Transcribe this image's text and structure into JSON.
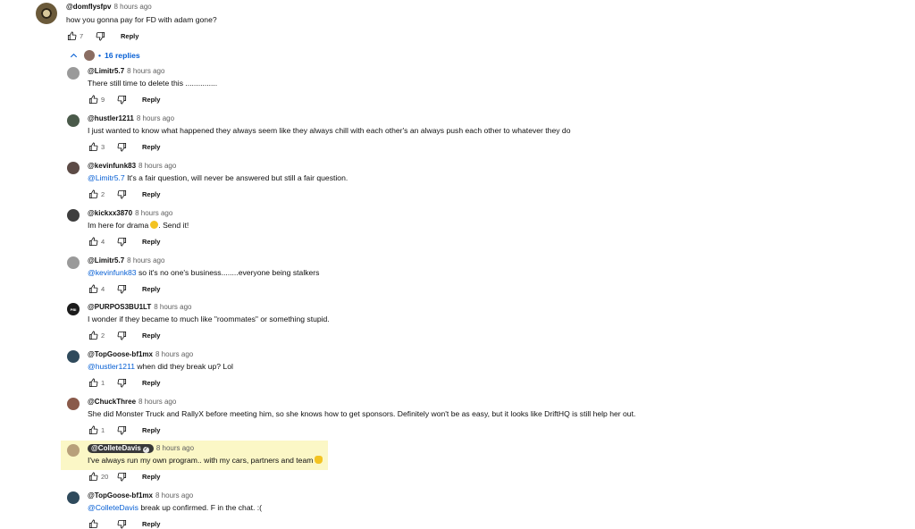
{
  "top_comment": {
    "author": "@domflysfpv",
    "time": "8 hours ago",
    "text": "how you gonna pay for FD with adam gone?",
    "likes": "7",
    "reply_label": "Reply"
  },
  "replies_toggle": {
    "label": "16 replies",
    "dot": "•"
  },
  "replies": [
    {
      "author": "@Limitr5.7",
      "time": "8 hours ago",
      "mention": "",
      "text": "There still time to delete this ...............",
      "likes": "9",
      "reply_label": "Reply",
      "avatar_color": "#9a9a9a"
    },
    {
      "author": "@hustler1211",
      "time": "8 hours ago",
      "mention": "",
      "text": "I just wanted to know what happened  they always seem like they always  chill with each other's an always push each other to whatever they do",
      "likes": "3",
      "reply_label": "Reply",
      "avatar_color": "#4a5a4a"
    },
    {
      "author": "@kevinfunk83",
      "time": "8 hours ago",
      "mention": "@Limitr5.7",
      "text": " It's a fair question, will never be answered but still a fair question.",
      "likes": "2",
      "reply_label": "Reply",
      "avatar_color": "#5c4b46"
    },
    {
      "author": "@kickxx3870",
      "time": "8 hours ago",
      "mention": "",
      "text": "Im here for drama",
      "text_after": ". Send it!",
      "likes": "4",
      "reply_label": "Reply",
      "avatar_color": "#3e3e3e"
    },
    {
      "author": "@Limitr5.7",
      "time": "8 hours ago",
      "mention": "@kevinfunk83",
      "text": " so it's no one's  business........everyone being stalkers",
      "likes": "4",
      "reply_label": "Reply",
      "avatar_color": "#9a9a9a"
    },
    {
      "author": "@PURPOS3BU1LT",
      "time": "8 hours ago",
      "mention": "",
      "text": "I wonder if they became to much like \"roommates\" or something stupid.",
      "likes": "2",
      "reply_label": "Reply",
      "avatar_color": "#1c1c1c",
      "avatar_text": "PBI"
    },
    {
      "author": "@TopGoose-bf1mx",
      "time": "8 hours ago",
      "mention": "@hustler1211",
      "text": " when did they break up? Lol",
      "likes": "1",
      "reply_label": "Reply",
      "avatar_color": "#2f4a5c"
    },
    {
      "author": "@ChuckThree",
      "time": "8 hours ago",
      "mention": "",
      "text": "She did Monster Truck and RallyX before meeting him, so she knows how to get sponsors. Definitely won't be as easy, but it looks like DriftHQ is still help her out.",
      "likes": "1",
      "reply_label": "Reply",
      "avatar_color": "#8a5a4a"
    },
    {
      "author": "@ColleteDavis",
      "time": "8 hours ago",
      "mention": "",
      "text": "I've always run my own program.. with my cars, partners and team",
      "likes": "20",
      "reply_label": "Reply",
      "avatar_color": "#b8a07a",
      "creator": true
    },
    {
      "author": "@TopGoose-bf1mx",
      "time": "8 hours ago",
      "mention": "@ColleteDavis",
      "text": " break up confirmed. F in the chat. :(",
      "likes": "",
      "reply_label": "Reply",
      "avatar_color": "#2f4a5c"
    }
  ],
  "colors": {
    "link_blue": "#065fd4",
    "highlight": "#fbf7c6",
    "creator_badge": "#383838"
  }
}
